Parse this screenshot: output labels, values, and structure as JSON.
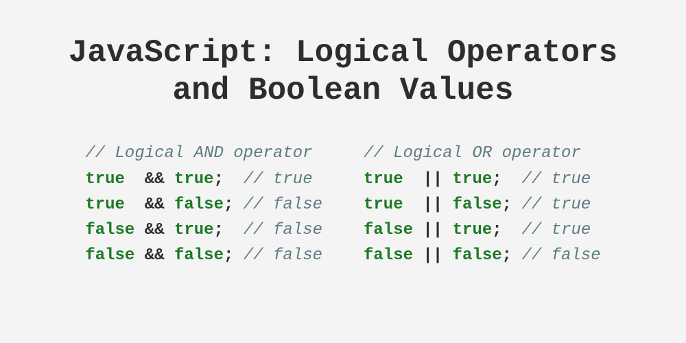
{
  "title_line1": "JavaScript: Logical Operators",
  "title_line2": "and Boolean Values",
  "blocks": {
    "and": {
      "header_comment": "// Logical AND operator",
      "op": "&&",
      "rows": [
        {
          "a": "true",
          "pad_a": "true ",
          "b": "true",
          "pad_b": "true;  ",
          "res": "// true"
        },
        {
          "a": "true",
          "pad_a": "true ",
          "b": "false",
          "pad_b": "false; ",
          "res": "// false"
        },
        {
          "a": "false",
          "pad_a": "false",
          "b": "true",
          "pad_b": "true;  ",
          "res": "// false"
        },
        {
          "a": "false",
          "pad_a": "false",
          "b": "false",
          "pad_b": "false; ",
          "res": "// false"
        }
      ]
    },
    "or": {
      "header_comment": "// Logical OR operator",
      "op": "||",
      "rows": [
        {
          "a": "true",
          "pad_a": "true ",
          "b": "true",
          "pad_b": "true;  ",
          "res": "// true"
        },
        {
          "a": "true",
          "pad_a": "true ",
          "b": "false",
          "pad_b": "false; ",
          "res": "// true"
        },
        {
          "a": "false",
          "pad_a": "false",
          "b": "true",
          "pad_b": "true;  ",
          "res": "// true"
        },
        {
          "a": "false",
          "pad_a": "false",
          "b": "false",
          "pad_b": "false; ",
          "res": "// false"
        }
      ]
    }
  }
}
